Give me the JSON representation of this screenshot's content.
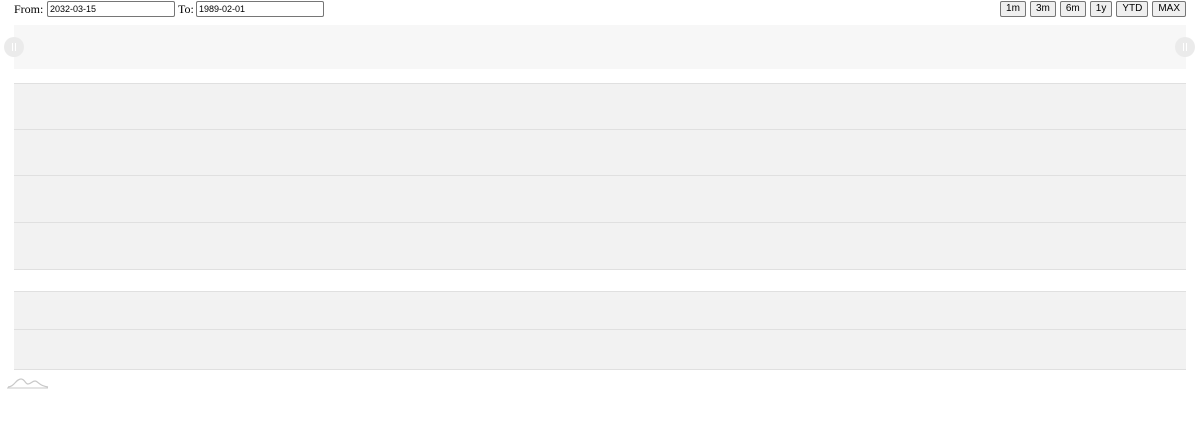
{
  "toolbar": {
    "from_label": "From:",
    "from_value": "2032-03-15",
    "to_label": "To:",
    "to_value": "1989-02-01",
    "range_buttons": [
      "1m",
      "3m",
      "6m",
      "1y",
      "YTD",
      "MAX"
    ]
  },
  "icons": {
    "left_handle": "grip-handle-icon",
    "right_handle": "grip-handle-icon",
    "brand": "wave-logo-icon"
  },
  "colors": {
    "navigator_bg": "#f7f7f7",
    "panel_bg": "#f2f2f2",
    "grid_line": "#e0e0e0",
    "handle": "#ebebeb"
  }
}
